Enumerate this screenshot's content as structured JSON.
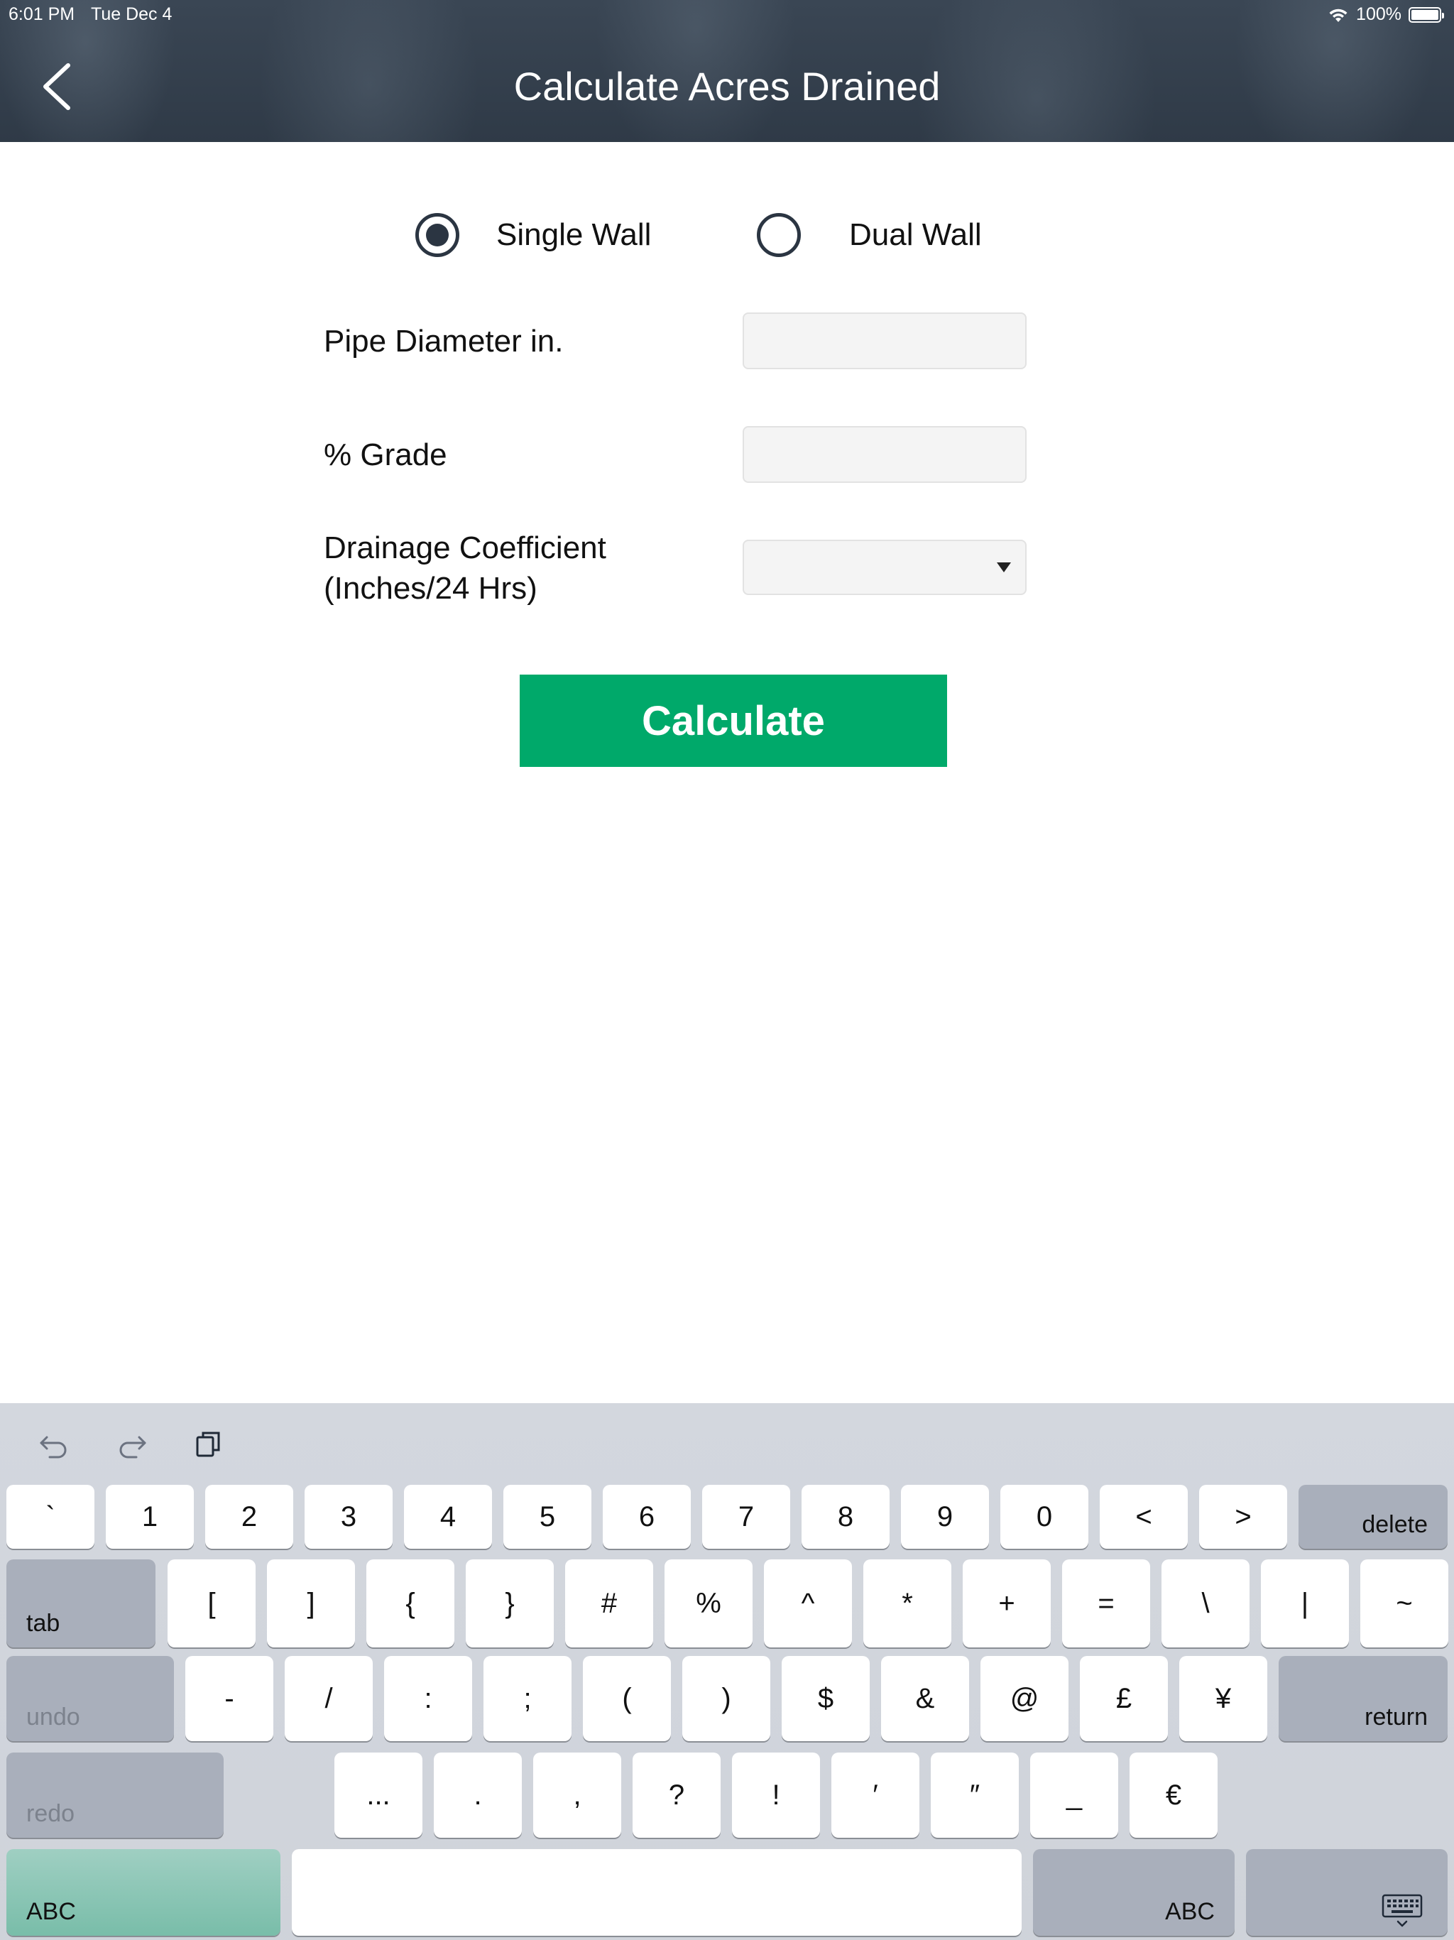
{
  "status_bar": {
    "time": "6:01 PM",
    "date": "Tue Dec 4",
    "battery": "100%"
  },
  "header": {
    "title": "Calculate Acres Drained"
  },
  "form": {
    "wall_options": [
      {
        "label": "Single Wall",
        "selected": true
      },
      {
        "label": "Dual Wall",
        "selected": false
      }
    ],
    "pipe_diameter": {
      "label": "Pipe Diameter in.",
      "value": ""
    },
    "grade": {
      "label": "% Grade",
      "value": ""
    },
    "drainage": {
      "label_line1": "Drainage Coefficient",
      "label_line2": "(Inches/24 Hrs)",
      "value": ""
    },
    "calculate_label": "Calculate"
  },
  "keyboard": {
    "row1": [
      "`",
      "1",
      "2",
      "3",
      "4",
      "5",
      "6",
      "7",
      "8",
      "9",
      "0",
      "<",
      ">"
    ],
    "delete": "delete",
    "tab": "tab",
    "row2": [
      "[",
      "]",
      "{",
      "}",
      "#",
      "%",
      "^",
      "*",
      "+",
      "=",
      "\\",
      "|",
      "~"
    ],
    "undo": "undo",
    "row3": [
      "-",
      "/",
      ":",
      ";",
      "(",
      ")",
      "$",
      "&",
      "@",
      "£",
      "¥"
    ],
    "return": "return",
    "redo": "redo",
    "row4": [
      "...",
      ".",
      ",",
      "?",
      "!",
      "′",
      "″",
      "_",
      "€"
    ],
    "abc_left": "ABC",
    "abc_right": "ABC"
  },
  "colors": {
    "accent": "#00a96a",
    "header_bg": "#2f3a47",
    "radio": "#2b3542"
  }
}
